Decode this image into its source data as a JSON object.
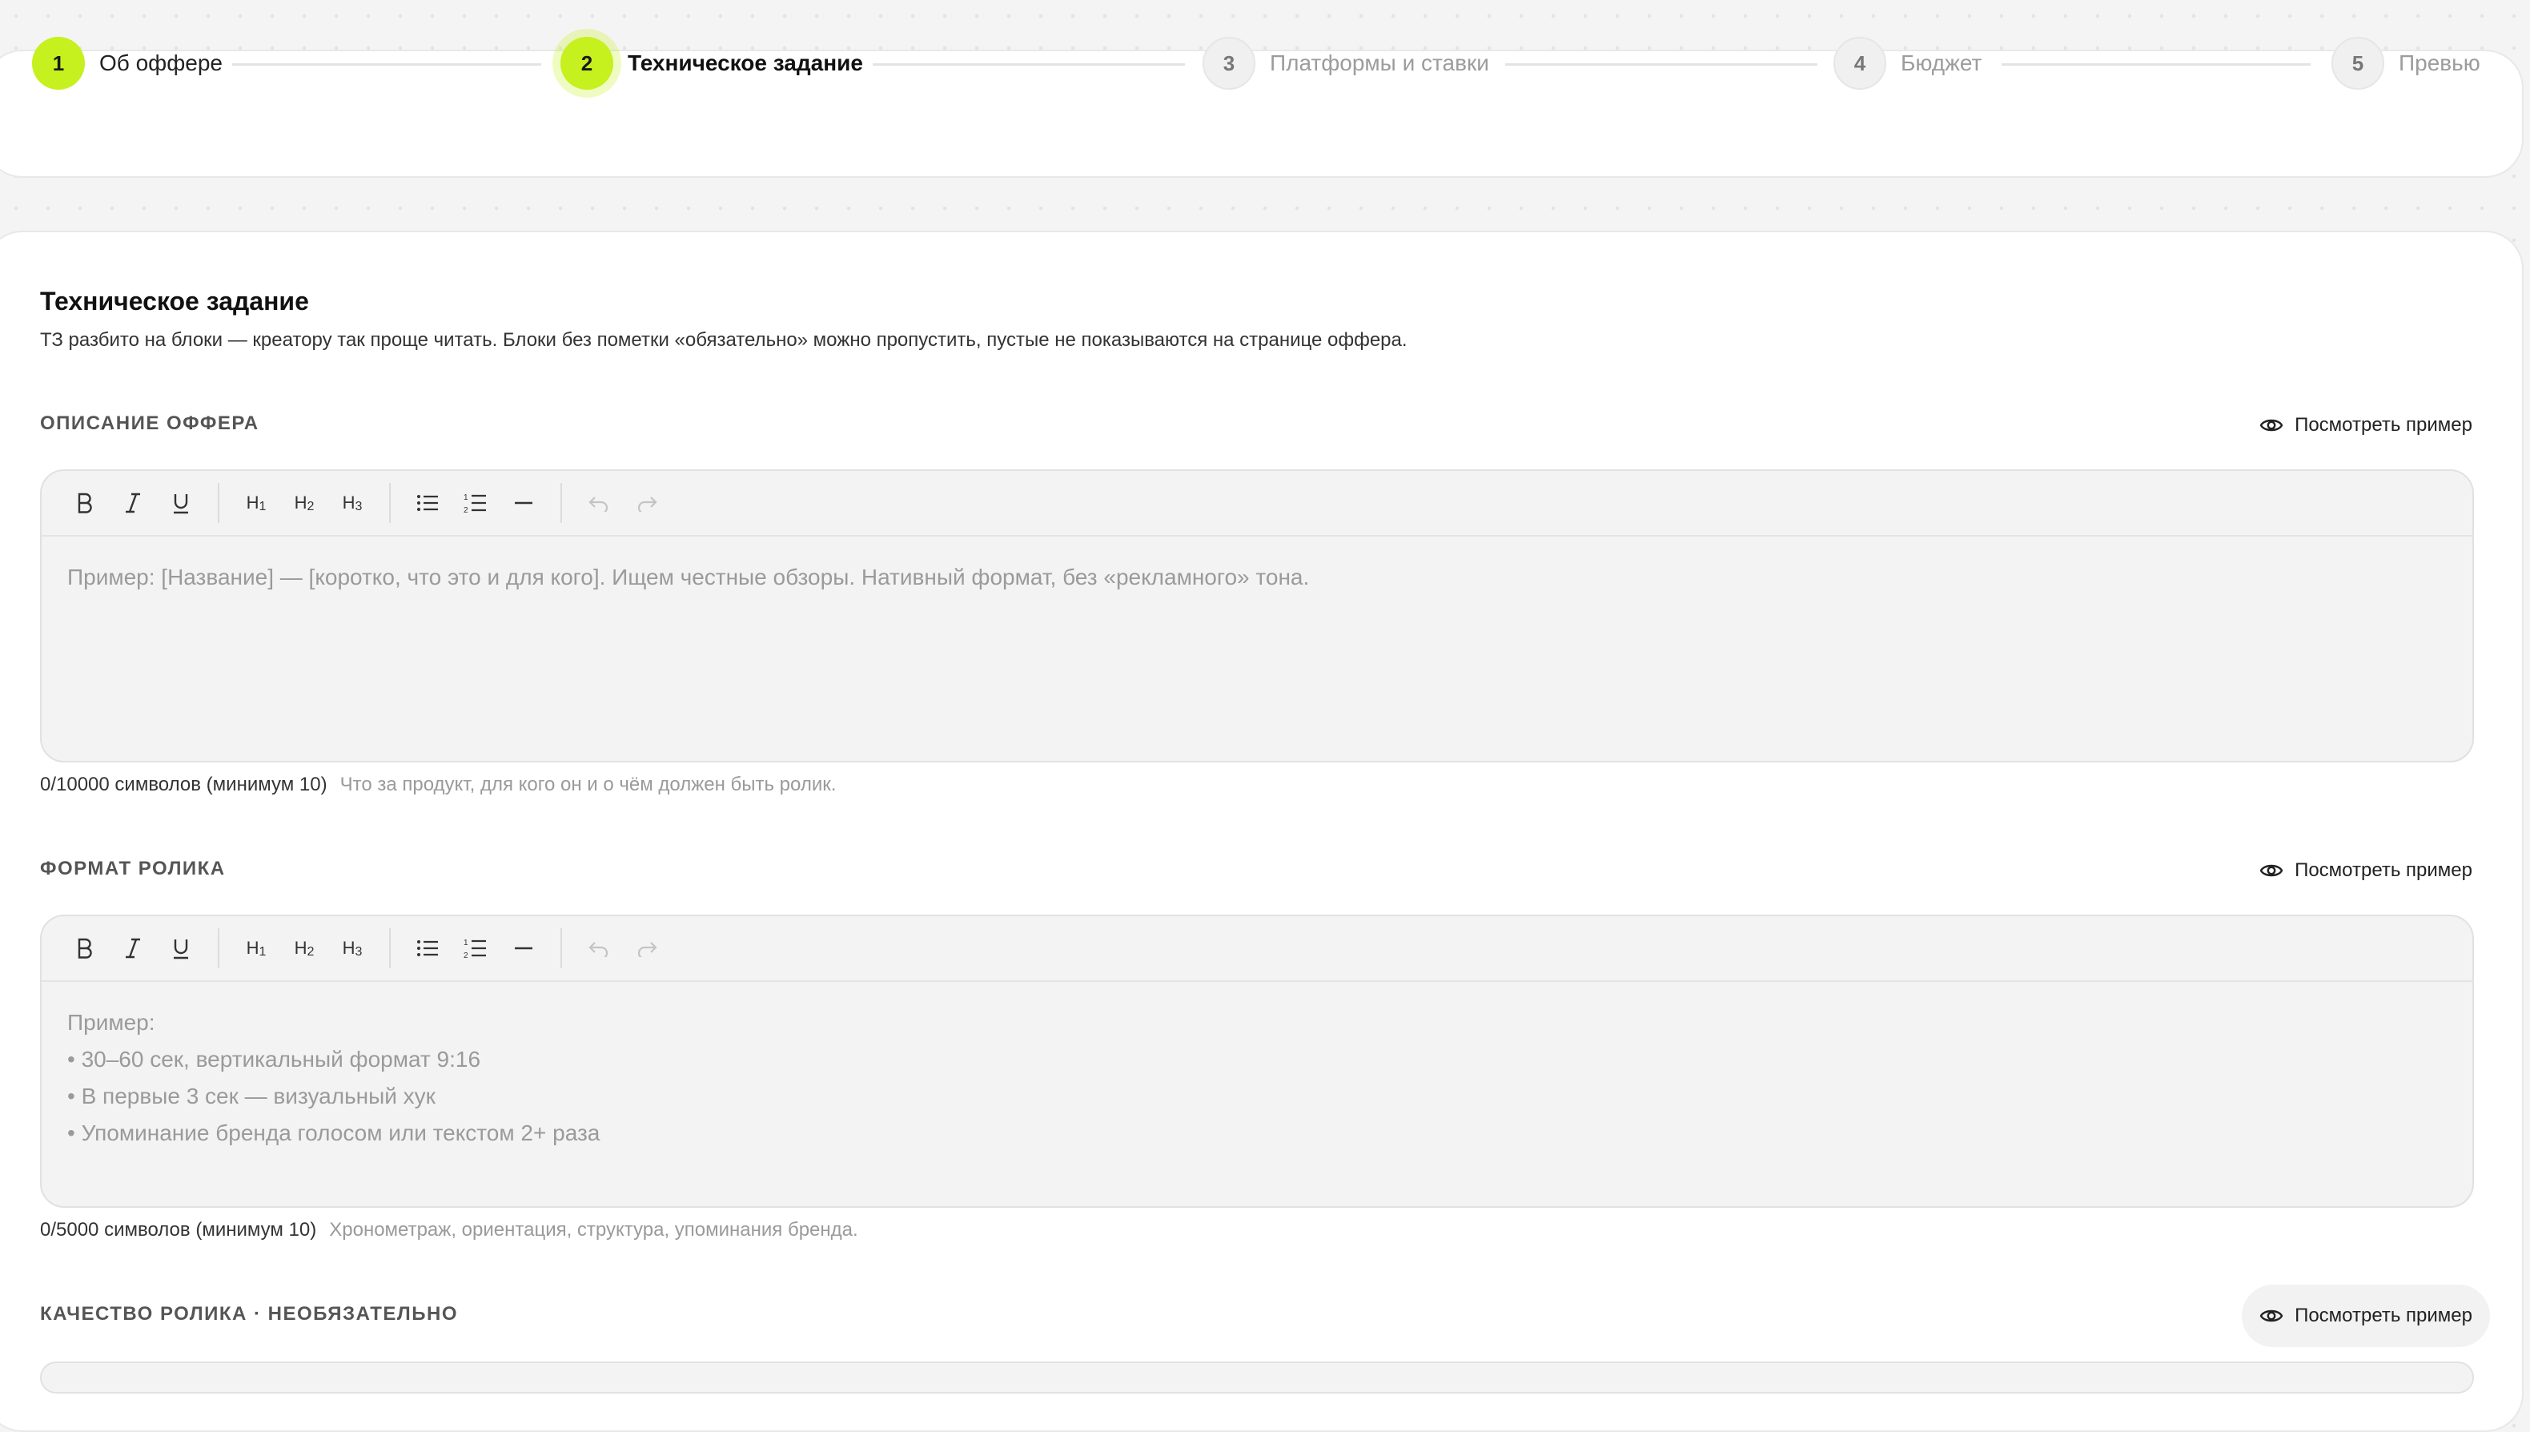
{
  "stepper": {
    "steps": [
      {
        "number": "1",
        "label": "Об оффере",
        "state": "done"
      },
      {
        "number": "2",
        "label": "Техническое задание",
        "state": "active"
      },
      {
        "number": "3",
        "label": "Платформы и ставки",
        "state": "todo"
      },
      {
        "number": "4",
        "label": "Бюджет",
        "state": "todo"
      },
      {
        "number": "5",
        "label": "Превью",
        "state": "todo"
      }
    ]
  },
  "page": {
    "title": "Техническое задание",
    "subtitle": "ТЗ разбито на блоки — креатору так проще читать. Блоки без пометки «обязательно» можно пропустить, пустые не показываются на странице оффера."
  },
  "toolbar": {
    "h1": "H",
    "h2": "H",
    "h3": "H",
    "h1_sub": "1",
    "h2_sub": "2",
    "h3_sub": "3"
  },
  "sections": [
    {
      "label": "ОПИСАНИЕ ОФФЕРА",
      "example_label": "Посмотреть пример",
      "placeholder": "Пример: [Название] — [коротко, что это и для кого]. Ищем честные обзоры. Нативный формат, без «рекламного» тона.",
      "counter": "0/10000 символов (минимум 10)",
      "hint": "Что за продукт, для кого он и о чём должен быть ролик."
    },
    {
      "label": "ФОРМАТ РОЛИКА",
      "example_label": "Посмотреть пример",
      "placeholder": "Пример:\n• 30–60 сек, вертикальный формат 9:16\n• В первые 3 сек — визуальный хук\n• Упоминание бренда голосом или текстом 2+ раза",
      "counter": "0/5000 символов (минимум 10)",
      "hint": "Хронометраж, ориентация, структура, упоминания бренда."
    },
    {
      "label": "КАЧЕСТВО РОЛИКА · НЕОБЯЗАТЕЛЬНО",
      "example_label": "Посмотреть пример"
    }
  ],
  "colors": {
    "accent": "#c6f01e",
    "background": "#f4f4f4",
    "editor_bg": "#f3f3f3"
  }
}
